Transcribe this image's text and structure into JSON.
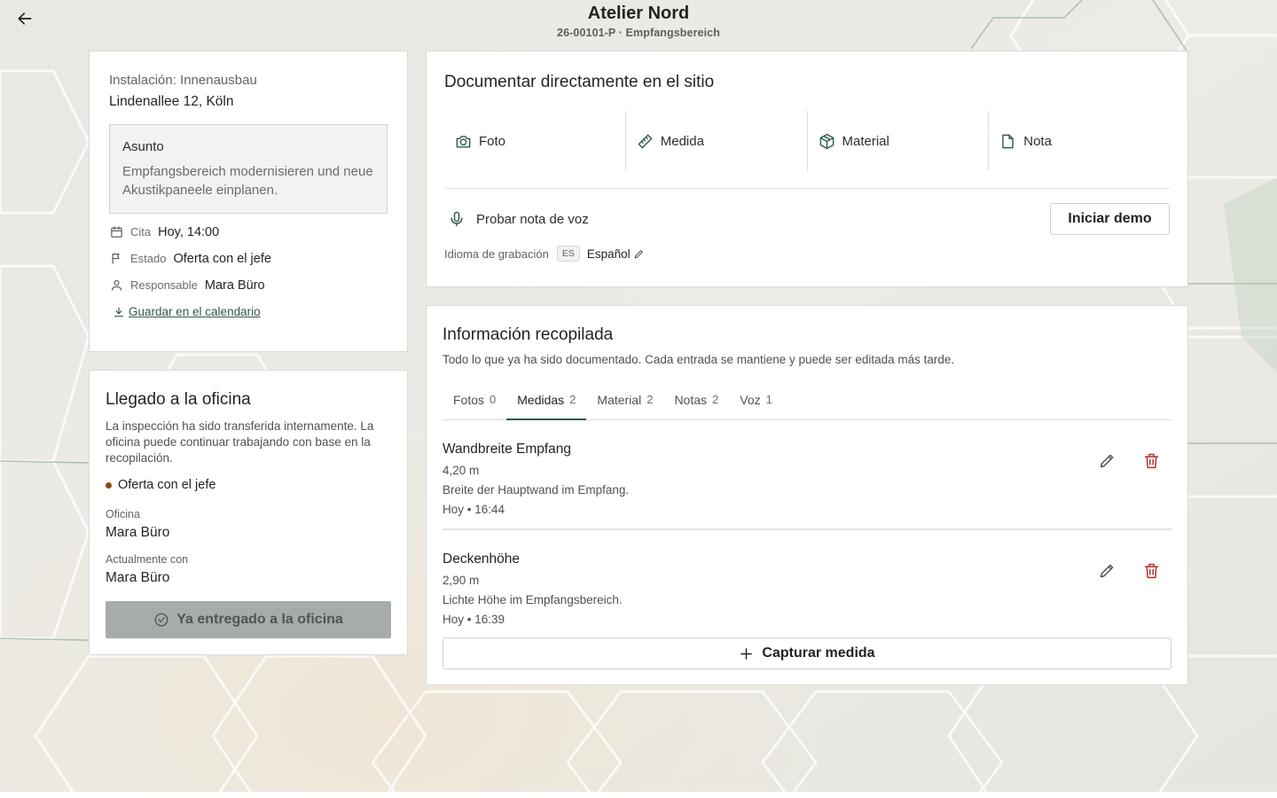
{
  "header": {
    "title": "Atelier Nord",
    "subtitle": "26-00101-P · Empfangsbereich"
  },
  "installation": {
    "label": "Instalación: Innenausbau",
    "address": "Lindenallee 12, Köln",
    "subject_title": "Asunto",
    "subject_text": "Empfangsbereich modernisieren und neue Akustikpaneele einplanen.",
    "appointment_label": "Cita",
    "appointment_value": "Hoy, 14:00",
    "status_label": "Estado",
    "status_value": "Oferta con el jefe",
    "owner_label": "Responsable",
    "owner_value": "Mara Büro",
    "calendar_link": "Guardar en el calendario"
  },
  "office": {
    "title": "Llegado a la oficina",
    "text": "La inspección ha sido transferida internamente. La oficina puede continuar trabajando con base en la recopilación.",
    "status": "Oferta con el jefe",
    "office_label": "Oficina",
    "office_value": "Mara Büro",
    "current_label": "Actualmente con",
    "current_value": "Mara Büro",
    "handed_button": "Ya entregado a la oficina"
  },
  "documentation": {
    "title": "Documentar directamente en el sitio",
    "actions": [
      {
        "label": "Foto",
        "icon": "camera-icon"
      },
      {
        "label": "Medida",
        "icon": "ruler-icon"
      },
      {
        "label": "Material",
        "icon": "package-icon"
      },
      {
        "label": "Nota",
        "icon": "document-icon"
      }
    ],
    "voice_label": "Probar nota de voz",
    "demo_button": "Iniciar demo",
    "language_label": "Idioma de grabación",
    "language_code": "ES",
    "language_value": "Español"
  },
  "info": {
    "title": "Información recopilada",
    "subtitle": "Todo lo que ya ha sido documentado. Cada entrada se mantiene y puede ser editada más tarde.",
    "tabs": [
      {
        "label": "Fotos",
        "count": "0"
      },
      {
        "label": "Medidas",
        "count": "2"
      },
      {
        "label": "Material",
        "count": "2"
      },
      {
        "label": "Notas",
        "count": "2"
      },
      {
        "label": "Voz",
        "count": "1"
      }
    ],
    "active_tab": "Medidas",
    "entries": [
      {
        "title": "Wandbreite Empfang",
        "value": "4,20 m",
        "description": "Breite der Hauptwand im Empfang.",
        "time": "Hoy • 16:44"
      },
      {
        "title": "Deckenhöhe",
        "value": "2,90 m",
        "description": "Lichte Höhe im Empfangsbereich.",
        "time": "Hoy • 16:39"
      }
    ],
    "capture_button": "Capturar medida"
  },
  "colors": {
    "accent": "#2f5c45",
    "delete": "#b42f2f",
    "status_dot": "#8a4a14"
  }
}
